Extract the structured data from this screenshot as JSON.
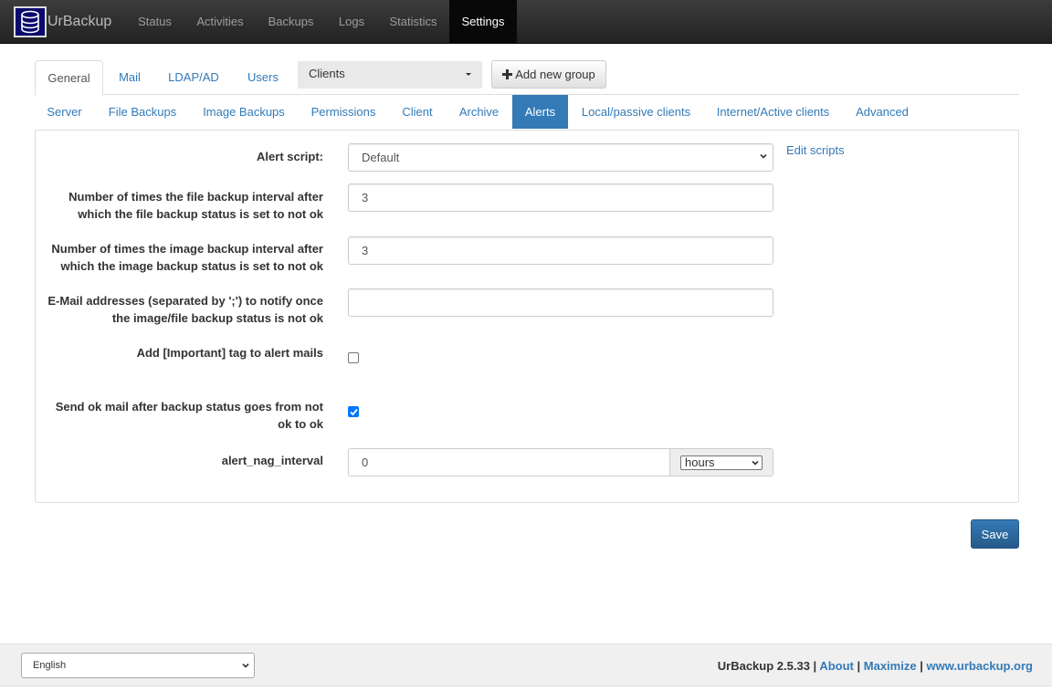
{
  "app": {
    "brand": "UrBackup",
    "logo_icon": "database-icon"
  },
  "nav": {
    "items": [
      {
        "label": "Status"
      },
      {
        "label": "Activities"
      },
      {
        "label": "Backups"
      },
      {
        "label": "Logs"
      },
      {
        "label": "Statistics"
      },
      {
        "label": "Settings",
        "active": true
      }
    ]
  },
  "settings_tabs": {
    "items": [
      {
        "label": "General",
        "active": true
      },
      {
        "label": "Mail"
      },
      {
        "label": "LDAP/AD"
      },
      {
        "label": "Users"
      }
    ],
    "group_select": "Clients",
    "add_group_label": "Add new group"
  },
  "sub_tabs": {
    "items": [
      {
        "label": "Server"
      },
      {
        "label": "File Backups"
      },
      {
        "label": "Image Backups"
      },
      {
        "label": "Permissions"
      },
      {
        "label": "Client"
      },
      {
        "label": "Archive"
      },
      {
        "label": "Alerts",
        "active": true
      },
      {
        "label": "Local/passive clients"
      },
      {
        "label": "Internet/Active clients"
      },
      {
        "label": "Advanced"
      }
    ]
  },
  "form": {
    "alert_script": {
      "label": "Alert script:",
      "value": "Default",
      "edit_link": "Edit scripts"
    },
    "file_backup_interval": {
      "label": "Number of times the file backup interval after which the file backup status is set to not ok",
      "value": "3"
    },
    "image_backup_interval": {
      "label": "Number of times the image backup interval after which the image backup status is set to not ok",
      "value": "3"
    },
    "email_addresses": {
      "label": "E-Mail addresses (separated by ';') to notify once the image/file backup status is not ok",
      "value": ""
    },
    "important_tag": {
      "label": "Add [Important] tag to alert mails",
      "checked": false
    },
    "send_ok_mail": {
      "label": "Send ok mail after backup status goes from not ok to ok",
      "checked": true
    },
    "nag_interval": {
      "label": "alert_nag_interval",
      "value": "0",
      "unit": "hours"
    },
    "save_label": "Save"
  },
  "footer": {
    "language": "English",
    "version_text": "UrBackup 2.5.33 |",
    "about": "About",
    "sep1": "|",
    "maximize": "Maximize",
    "sep2": "|",
    "website": "www.urbackup.org"
  },
  "colors": {
    "accent": "#337ab7",
    "navbar": "#222222",
    "checkbox_checked": "#0075ff"
  }
}
